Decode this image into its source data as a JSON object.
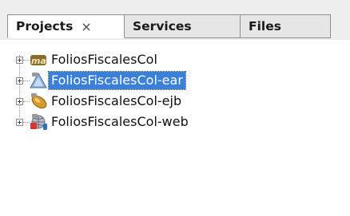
{
  "tabs": [
    {
      "label": "Projects",
      "close": "×",
      "active": true
    },
    {
      "label": "Services",
      "active": false
    },
    {
      "label": "Files",
      "active": false
    }
  ],
  "tree": {
    "items": [
      {
        "label": "FoliosFiscalesCol",
        "icon": "maven-project-icon",
        "selected": false
      },
      {
        "label": "FoliosFiscalesCol-ear",
        "icon": "ear-triangle-icon",
        "selected": true
      },
      {
        "label": "FoliosFiscalesCol-ejb",
        "icon": "ejb-bean-icon",
        "selected": false
      },
      {
        "label": "FoliosFiscalesCol-web",
        "icon": "web-globe-icon",
        "selected": false
      }
    ]
  },
  "colors": {
    "selection": "#3a7fd8",
    "tab_bar": "#eeeeee"
  }
}
